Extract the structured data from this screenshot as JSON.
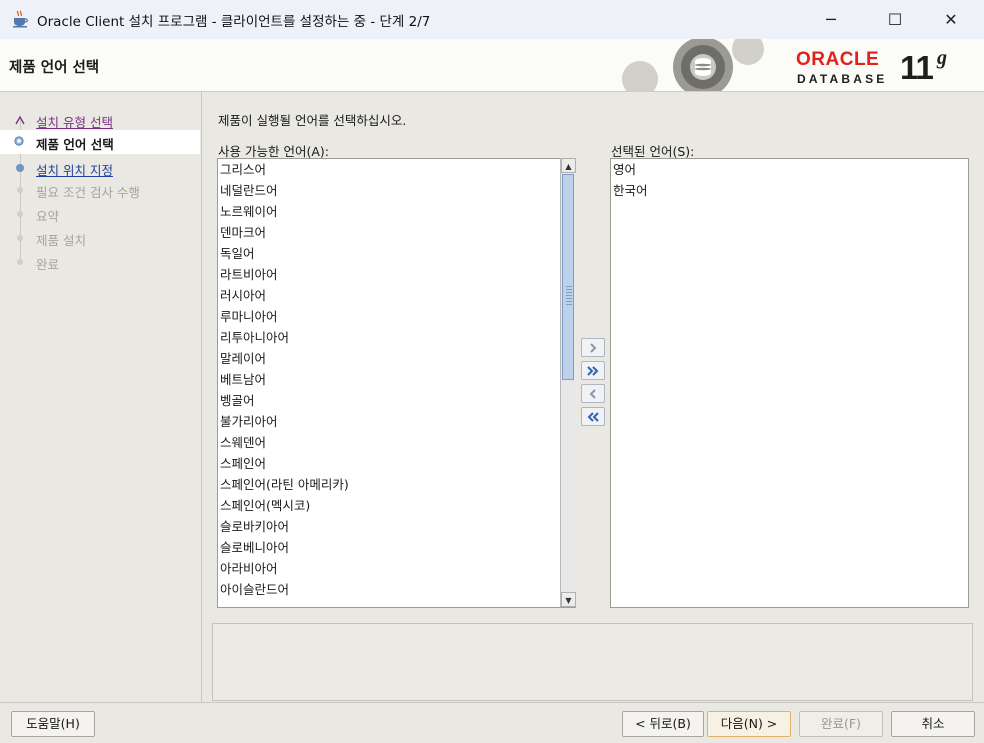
{
  "window": {
    "title": "Oracle Client 설치 프로그램 - 클라이언트를 설정하는 중 - 단계 2/7",
    "controls": {
      "minimize": "─",
      "maximize": "☐",
      "close": "✕"
    }
  },
  "header": {
    "page_title": "제품 언어 선택",
    "logo": {
      "brand": "ORACLE",
      "product": "DATABASE",
      "version": "11",
      "version_suffix": "g"
    }
  },
  "nav": {
    "steps": [
      {
        "label": "설치 유형 선택",
        "state": "done"
      },
      {
        "label": "제품 언어 선택",
        "state": "current"
      },
      {
        "label": "설치 위치 지정",
        "state": "link"
      },
      {
        "label": "필요 조건 검사 수행",
        "state": "disabled"
      },
      {
        "label": "요약",
        "state": "disabled"
      },
      {
        "label": "제품 설치",
        "state": "disabled"
      },
      {
        "label": "완료",
        "state": "disabled"
      }
    ]
  },
  "content": {
    "instruction": "제품이 실행될 언어를 선택하십시오.",
    "available_label": "사용 가능한 언어(A):",
    "selected_label": "선택된 언어(S):",
    "available_languages": [
      "그리스어",
      "네덜란드어",
      "노르웨이어",
      "덴마크어",
      "독일어",
      "라트비아어",
      "러시아어",
      "루마니아어",
      "리투아니아어",
      "말레이어",
      "베트남어",
      "벵골어",
      "불가리아어",
      "스웨덴어",
      "스페인어",
      "스페인어(라틴 아메리카)",
      "스페인어(멕시코)",
      "슬로바키아어",
      "슬로베니아어",
      "아라비아어",
      "아이슬란드어"
    ],
    "selected_languages": [
      "영어",
      "한국어"
    ]
  },
  "buttons": {
    "help": "도움말(H)",
    "back": "< 뒤로(B)",
    "next": "다음(N) >",
    "finish": "완료(F)",
    "cancel": "취소"
  },
  "colors": {
    "oracle_red": "#e2211c",
    "current_step_bg": "#ffffff",
    "visited_link": "#7a2f88",
    "link": "#1f3f9a",
    "disabled_text": "#a6a49c",
    "scroll_thumb": "#bed1ea"
  },
  "icons": {
    "app": "java-coffee-cup-icon",
    "move_right": "chevron-right-icon",
    "move_all_right": "double-chevron-right-icon",
    "move_left": "chevron-left-icon",
    "move_all_left": "double-chevron-left-icon"
  }
}
